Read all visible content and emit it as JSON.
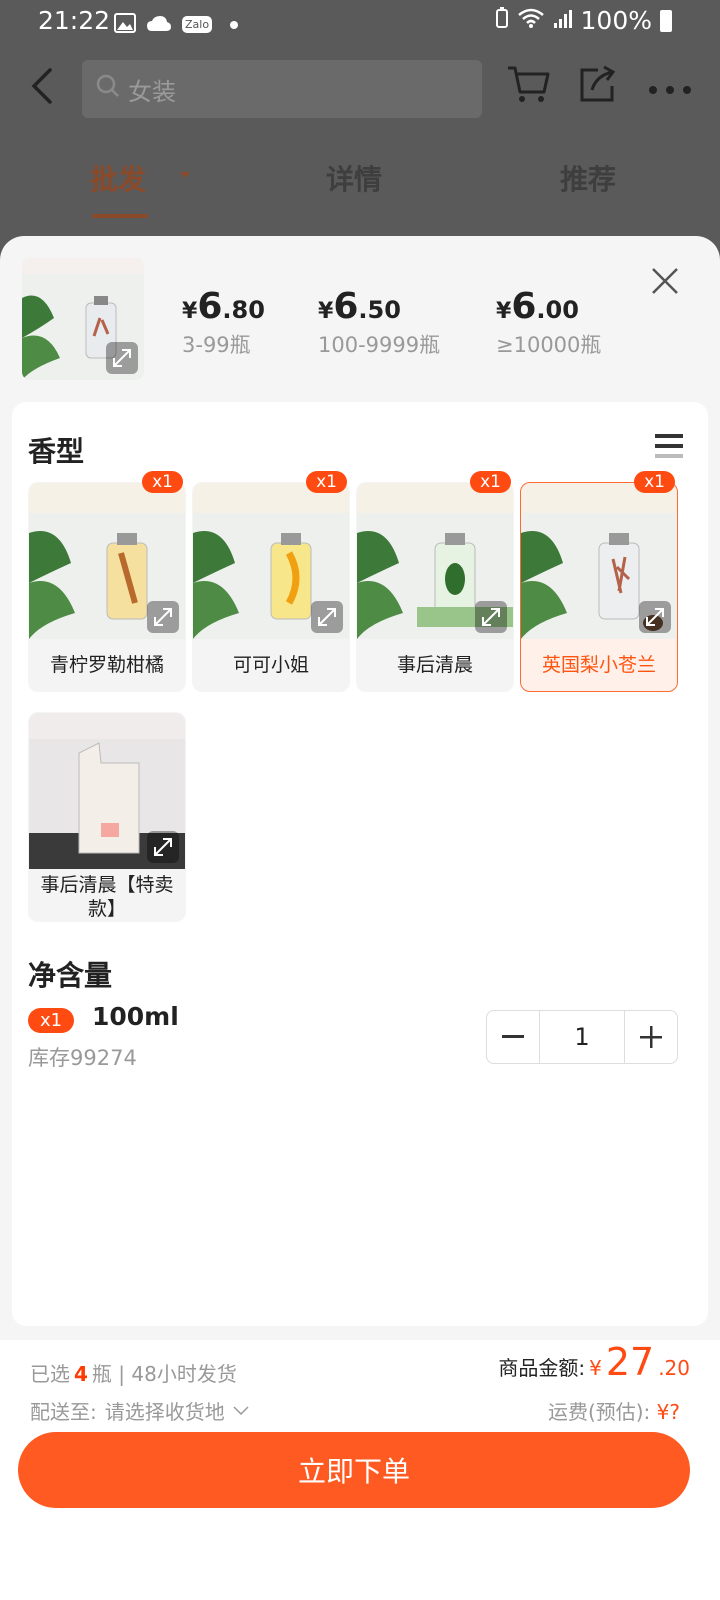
{
  "status": {
    "time": "21:22",
    "zalo": "Zalo",
    "battery": "100%"
  },
  "header": {
    "search_placeholder": "女装",
    "tabs": [
      {
        "label": "批发"
      },
      {
        "label": "详情"
      },
      {
        "label": "推荐"
      }
    ]
  },
  "prices": [
    {
      "currency": "¥",
      "int": "6",
      "dec": ".80",
      "range": "3-99瓶"
    },
    {
      "currency": "¥",
      "int": "6",
      "dec": ".50",
      "range": "100-9999瓶"
    },
    {
      "currency": "¥",
      "int": "6",
      "dec": ".00",
      "range": "≥10000瓶"
    }
  ],
  "scent": {
    "title": "香型",
    "variants": [
      {
        "label": "青柠罗勒柑橘",
        "badge": "x1",
        "color": "#e7b43a"
      },
      {
        "label": "可可小姐",
        "badge": "x1",
        "color": "#f0b21a"
      },
      {
        "label": "事后清晨",
        "badge": "x1",
        "color": "#8fcf7a"
      },
      {
        "label": "英国梨小苍兰",
        "badge": "x1",
        "color": "#b4624a"
      },
      {
        "label": "事后清晨【特卖款】",
        "badge": "",
        "color": "#e8d0c0"
      }
    ],
    "selected_index": 3
  },
  "volume": {
    "title": "净含量",
    "badge": "x1",
    "size": "100ml",
    "stock": "库存99274",
    "quantity": "1"
  },
  "footer": {
    "selected_prefix": "已选",
    "selected_count": "4",
    "selected_suffix": "瓶 | 48小时发货",
    "ship_label": "配送至:",
    "ship_value": "请选择收货地",
    "amount_label": "商品金额:",
    "amount_currency": "¥",
    "amount_int": "27",
    "amount_dec": ".20",
    "fee_label": "运费(预估):",
    "fee_value": "¥?",
    "order_button": "立即下单"
  },
  "colors": {
    "accent": "#ff5a22",
    "badge": "#ff4a12"
  }
}
